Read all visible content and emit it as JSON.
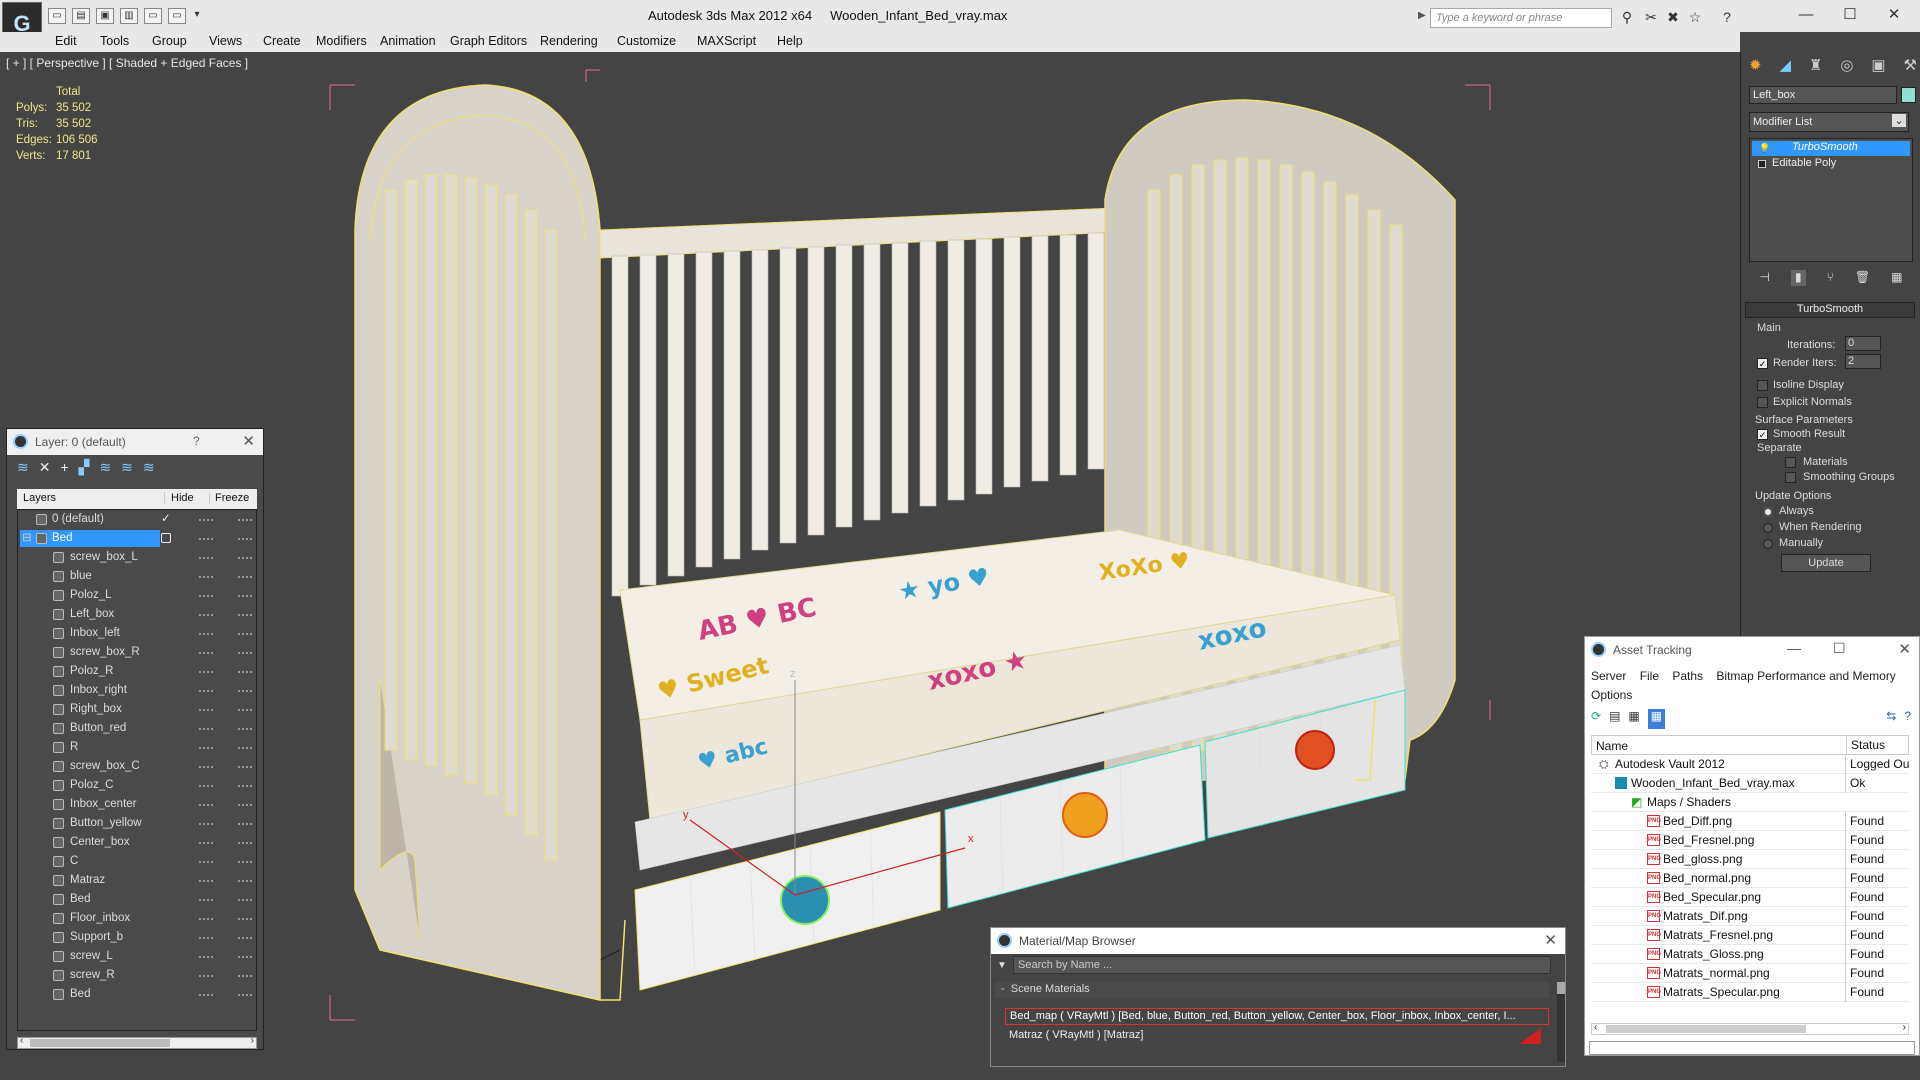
{
  "app": {
    "title": "Autodesk 3ds Max  2012 x64",
    "filename": "Wooden_Infant_Bed_vray.max",
    "search_placeholder": "Type a keyword or phrase"
  },
  "menu": [
    "Edit",
    "Tools",
    "Group",
    "Views",
    "Create",
    "Modifiers",
    "Animation",
    "Graph Editors",
    "Rendering",
    "Customize",
    "MAXScript",
    "Help"
  ],
  "viewport": {
    "label": "[ + ] [ Perspective ] [ Shaded + Edged Faces ]",
    "stats": {
      "header": "Total",
      "polys_label": "Polys:",
      "polys": "35 502",
      "tris_label": "Tris:",
      "tris": "35 502",
      "edges_label": "Edges:",
      "edges": "106 506",
      "verts_label": "Verts:",
      "verts": "17 801"
    }
  },
  "command_panel": {
    "object_name": "Left_box",
    "modifier_list": "Modifier List",
    "stack": [
      "TurboSmooth",
      "Editable Poly"
    ],
    "rollout_title": "TurboSmooth",
    "main_label": "Main",
    "iterations_label": "Iterations:",
    "iterations": "0",
    "render_iters_label": "Render Iters:",
    "render_iters": "2",
    "isoline": "Isoline Display",
    "explicit": "Explicit Normals",
    "surface_params": "Surface Parameters",
    "smooth_result": "Smooth Result",
    "separate": "Separate",
    "materials": "Materials",
    "smoothing_groups": "Smoothing Groups",
    "update_options": "Update Options",
    "always": "Always",
    "when_rendering": "When Rendering",
    "manually": "Manually",
    "update_btn": "Update"
  },
  "layer_panel": {
    "title": "Layer: 0 (default)",
    "help": "?",
    "col_layers": "Layers",
    "col_hide": "Hide",
    "col_freeze": "Freeze",
    "layers": [
      {
        "name": "0 (default)",
        "level": 0
      },
      {
        "name": "Bed",
        "level": 0,
        "selected": true
      }
    ],
    "objects": [
      "screw_box_L",
      "blue",
      "Poloz_L",
      "Left_box",
      "Inbox_left",
      "screw_box_R",
      "Poloz_R",
      "Inbox_right",
      "Right_box",
      "Button_red",
      "R",
      "screw_box_C",
      "Poloz_C",
      "Inbox_center",
      "Button_yellow",
      "Center_box",
      "C",
      "Matraz",
      "Bed",
      "Floor_inbox",
      "Support_b",
      "screw_L",
      "screw_R",
      "Bed"
    ]
  },
  "asset_panel": {
    "title": "Asset Tracking",
    "menu": [
      "Server",
      "File",
      "Paths",
      "Bitmap Performance and Memory",
      "Options"
    ],
    "col_name": "Name",
    "col_status": "Status",
    "rows": [
      {
        "name": "Autodesk Vault 2012",
        "status": "Logged Ou",
        "indent": 0,
        "kind": "vault"
      },
      {
        "name": "Wooden_Infant_Bed_vray.max",
        "status": "Ok",
        "indent": 1,
        "kind": "max"
      },
      {
        "name": "Maps / Shaders",
        "status": "",
        "indent": 2,
        "kind": "folder"
      },
      {
        "name": "Bed_Diff.png",
        "status": "Found",
        "indent": 3,
        "kind": "png"
      },
      {
        "name": "Bed_Fresnel.png",
        "status": "Found",
        "indent": 3,
        "kind": "png"
      },
      {
        "name": "Bed_gloss.png",
        "status": "Found",
        "indent": 3,
        "kind": "png"
      },
      {
        "name": "Bed_normal.png",
        "status": "Found",
        "indent": 3,
        "kind": "png"
      },
      {
        "name": "Bed_Specular.png",
        "status": "Found",
        "indent": 3,
        "kind": "png"
      },
      {
        "name": "Matrats_Dif.png",
        "status": "Found",
        "indent": 3,
        "kind": "png"
      },
      {
        "name": "Matrats_Fresnel.png",
        "status": "Found",
        "indent": 3,
        "kind": "png"
      },
      {
        "name": "Matrats_Gloss.png",
        "status": "Found",
        "indent": 3,
        "kind": "png"
      },
      {
        "name": "Matrats_normal.png",
        "status": "Found",
        "indent": 3,
        "kind": "png"
      },
      {
        "name": "Matrats_Specular.png",
        "status": "Found",
        "indent": 3,
        "kind": "png"
      }
    ]
  },
  "material_browser": {
    "title": "Material/Map Browser",
    "search_placeholder": "Search by Name ...",
    "section": "Scene Materials",
    "items": [
      "Bed_map  ( VRayMtl )  [Bed, blue, Button_red, Button_yellow, Center_box, Floor_inbox, Inbox_center, I...",
      "Matraz  ( VRayMtl )  [Matraz]"
    ]
  },
  "axis": {
    "x": "x",
    "y": "y",
    "z": "z"
  },
  "colors": {
    "selection": "#3296ff",
    "wire": "#f0e070",
    "cyan_wire": "#40e0d0",
    "viewport_bg": "#444444"
  }
}
